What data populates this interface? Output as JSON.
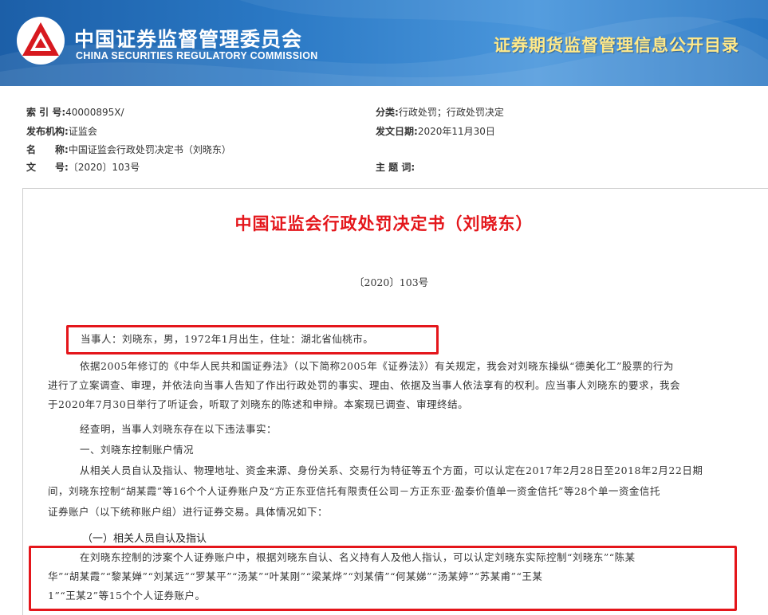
{
  "header": {
    "org_name_cn": "中国证券监督管理委员会",
    "org_name_en": "CHINA SECURITIES REGULATORY COMMISSION",
    "section_title": "证券期货监督管理信息公开目录",
    "logo_icon": "csrc-logo-icon"
  },
  "meta": {
    "index_label": "索 引 号:",
    "index_value": "40000895X/",
    "category_label": "分类:",
    "category_value": "行政处罚；行政处罚决定",
    "issuer_label": "发布机构:",
    "issuer_value": "证监会",
    "date_label": "发文日期:",
    "date_value": "2020年11月30日",
    "name_label_1": "名",
    "name_label_2": "称:",
    "name_value": "中国证监会行政处罚决定书（刘晓东）",
    "docno_label_1": "文",
    "docno_label_2": "号:",
    "docno_value": "〔2020〕103号",
    "subject_label": "主 题 词:",
    "subject_value": ""
  },
  "document": {
    "title": "中国证监会行政处罚决定书（刘晓东）",
    "number": "〔2020〕103号",
    "party": "当事人：刘晓东，男，1972年1月出生，住址：湖北省仙桃市。",
    "para1": [
      "依据2005年修订的《中华人民共和国证券法》（以下简称2005年《证券法》）有关规定，我会对刘晓东操纵“德美化工”股票的行为",
      "进行了立案调查、审理，并依法向当事人告知了作出行政处罚的事实、理由、依据及当事人依法享有的权利。应当事人刘晓东的要求，我会",
      "于2020年7月30日举行了听证会，听取了刘晓东的陈述和申辩。本案现已调查、审理终结。"
    ],
    "para2": "经查明，当事人刘晓东存在以下违法事实：",
    "heading1": "一、刘晓东控制账户情况",
    "para3": [
      "从相关人员自认及指认、物理地址、资金来源、身份关系、交易行为特征等五个方面，可以认定在2017年2月28日至2018年2月22日期",
      "间，刘晓东控制“胡某霞”等16个个人证券账户及“方正东亚信托有限责任公司－方正东亚·盈泰价值单一资金信托”等28个单一资金信托",
      "证券账户（以下统称账户组）进行证券交易。具体情况如下："
    ],
    "subheading": "（一）相关人员自认及指认",
    "para4": [
      "在刘晓东控制的涉案个人证券账户中，根据刘晓东自认、名义持有人及他人指认，可以认定刘晓东实际控制“刘晓东”“陈某",
      "华”“胡某霞”“黎某婵”“刘某远”“罗某平”“汤某”“叶某刚”“梁某烨”“刘某倩”“何某娣”“汤某婷”“苏某甫”“王某",
      "1”“王某2”等15个个人证券账户。"
    ]
  },
  "colors": {
    "banner_blue": "#2a78c4",
    "title_red": "#e4161b",
    "highlight_box": "#e4161b",
    "section_title_yellow": "#ffe98a"
  }
}
